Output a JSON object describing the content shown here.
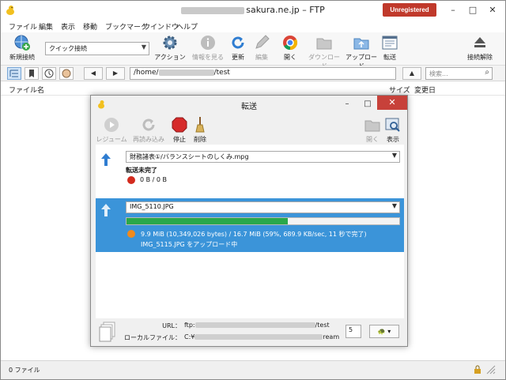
{
  "window": {
    "title_suffix": "sakura.ne.jp – FTP",
    "unregistered": "Unregistered",
    "minimize": "–",
    "maximize": "□",
    "close": "✕"
  },
  "menu": [
    "ファイル",
    "編集",
    "表示",
    "移動",
    "ブックマーク",
    "ウインドウ",
    "ヘルプ"
  ],
  "toolbar": {
    "new_connection": "新規接続",
    "quick_connect": "クイック接続",
    "action": "アクション",
    "info": "情報を見る",
    "refresh": "更新",
    "edit": "編集",
    "open": "開く",
    "download": "ダウンロード",
    "upload": "アップロード",
    "transfer": "転送",
    "disconnect": "接続解除"
  },
  "pathbar": {
    "back": "◀",
    "forward": "▶",
    "path_prefix": "/home/",
    "path_suffix": "/test",
    "up": "▲",
    "search_placeholder": "検索..."
  },
  "columns": {
    "name": "ファイル名",
    "size": "サイズ",
    "modified": "変更日"
  },
  "status": {
    "text": "0 ファイル"
  },
  "dialog": {
    "title": "転送",
    "close": "✕",
    "minimize": "–",
    "maximize": "□",
    "toolbar": {
      "resume": "レジューム",
      "reload": "再読み込み",
      "stop": "停止",
      "delete": "削除",
      "open": "開く",
      "show": "表示"
    },
    "transfers": [
      {
        "file": "財務諸表①/バランスシートのしくみ.mpg",
        "status": "転送未完了",
        "size": "0 B / 0 B",
        "dot_color": "#d32b1e"
      },
      {
        "file": "IMG_5110.JPG",
        "progress": 0.59,
        "info": "9.9 MiB (10,349,026 bytes) / 16.7 MiB (59%, 689.9 KB/sec, 11 秒で完了)",
        "detail": "IMG_5115.JPG をアップロード中",
        "dot_color": "#f08a1c"
      }
    ],
    "footer": {
      "url_label": "URL：",
      "url_prefix": "ftp:",
      "url_suffix": "/test",
      "local_label": "ローカルファイル：",
      "local_prefix": "C:¥",
      "local_suffix": "ream",
      "connections": "5"
    }
  },
  "colors": {
    "accent": "#3b94d9",
    "progress": "#2aa84a",
    "unregistered": "#c0392b",
    "close": "#c7413a"
  }
}
